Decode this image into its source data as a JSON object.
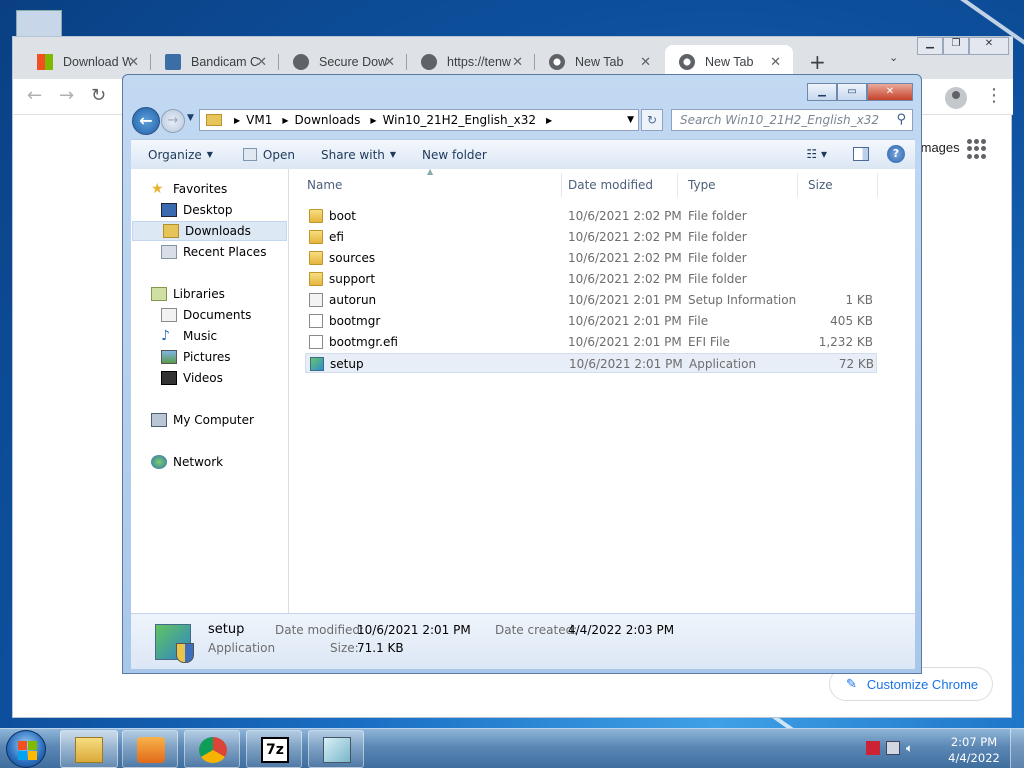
{
  "chrome": {
    "tabs": [
      {
        "title": "Download W",
        "icon": "windows-logo-icon",
        "color": "#f25022"
      },
      {
        "title": "Bandicam C",
        "icon": "bandicam-icon",
        "color": "#3a6ea5"
      },
      {
        "title": "Secure Dow",
        "icon": "globe-icon",
        "color": "#5f6368"
      },
      {
        "title": "https://tenw",
        "icon": "globe-icon",
        "color": "#5f6368"
      },
      {
        "title": "New Tab",
        "icon": "chrome-icon",
        "color": "#5f6368"
      },
      {
        "title": "New Tab",
        "icon": "chrome-icon",
        "color": "#5f6368"
      }
    ],
    "images_link": "Images",
    "customize_label": "Customize Chrome"
  },
  "explorer": {
    "breadcrumb": [
      "VM1",
      "Downloads",
      "Win10_21H2_English_x32"
    ],
    "search_placeholder": "Search Win10_21H2_English_x32",
    "commands": {
      "organize": "Organize",
      "open": "Open",
      "share": "Share with",
      "new_folder": "New folder"
    },
    "nav": {
      "favorites": "Favorites",
      "desktop": "Desktop",
      "downloads": "Downloads",
      "recent": "Recent Places",
      "libraries": "Libraries",
      "documents": "Documents",
      "music": "Music",
      "pictures": "Pictures",
      "videos": "Videos",
      "computer": "My Computer",
      "network": "Network"
    },
    "columns": {
      "name": "Name",
      "date": "Date modified",
      "type": "Type",
      "size": "Size"
    },
    "files": [
      {
        "name": "boot",
        "date": "10/6/2021 2:02 PM",
        "type": "File folder",
        "size": "",
        "icon": "folder-icon"
      },
      {
        "name": "efi",
        "date": "10/6/2021 2:02 PM",
        "type": "File folder",
        "size": "",
        "icon": "folder-icon"
      },
      {
        "name": "sources",
        "date": "10/6/2021 2:02 PM",
        "type": "File folder",
        "size": "",
        "icon": "folder-icon"
      },
      {
        "name": "support",
        "date": "10/6/2021 2:02 PM",
        "type": "File folder",
        "size": "",
        "icon": "folder-icon"
      },
      {
        "name": "autorun",
        "date": "10/6/2021 2:01 PM",
        "type": "Setup Information",
        "size": "1 KB",
        "icon": "setup-info-icon"
      },
      {
        "name": "bootmgr",
        "date": "10/6/2021 2:01 PM",
        "type": "File",
        "size": "405 KB",
        "icon": "file-icon"
      },
      {
        "name": "bootmgr.efi",
        "date": "10/6/2021 2:01 PM",
        "type": "EFI File",
        "size": "1,232 KB",
        "icon": "file-icon"
      },
      {
        "name": "setup",
        "date": "10/6/2021 2:01 PM",
        "type": "Application",
        "size": "72 KB",
        "icon": "setup-app-icon",
        "selected": true
      }
    ],
    "details": {
      "name": "setup",
      "type": "Application",
      "modified_label": "Date modified:",
      "modified": "10/6/2021 2:01 PM",
      "created_label": "Date created:",
      "created": "4/4/2022 2:03 PM",
      "size_label": "Size:",
      "size": "71.1 KB"
    }
  },
  "taskbar": {
    "time": "2:07 PM",
    "date": "4/4/2022"
  }
}
